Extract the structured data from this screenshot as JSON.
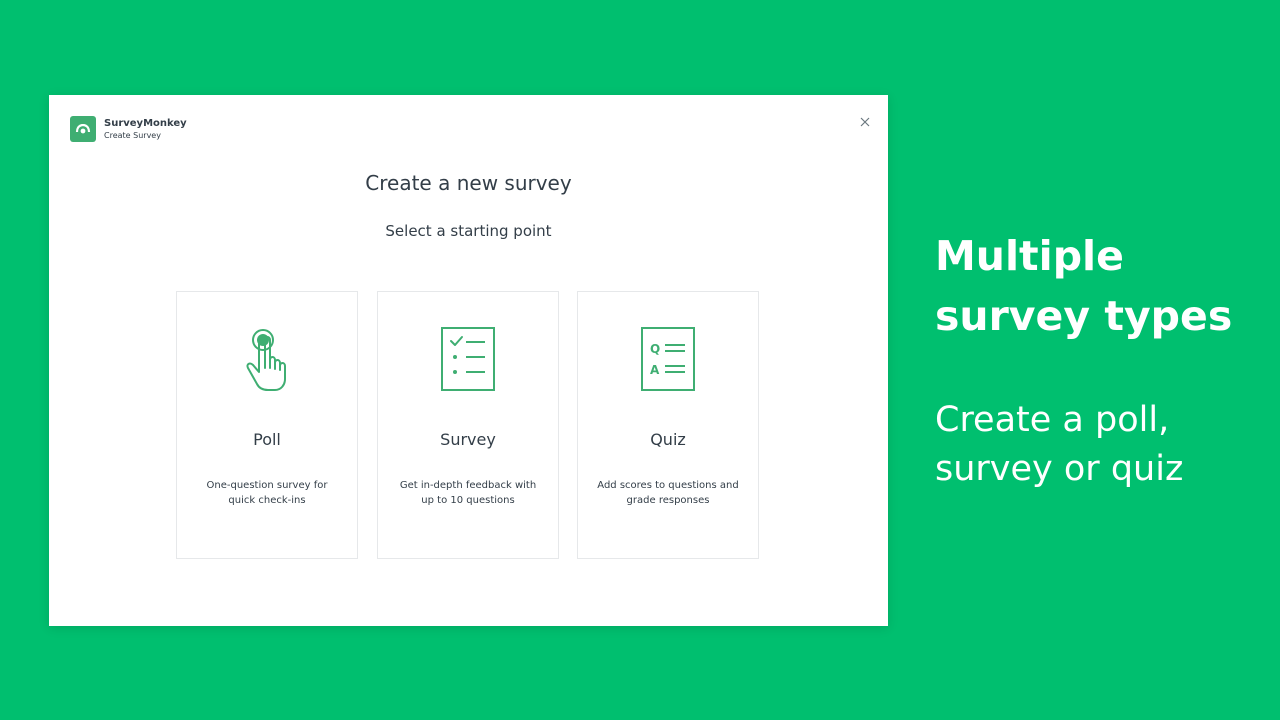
{
  "colors": {
    "background": "#00bf6f",
    "icon_green": "#3fae72",
    "text_dark": "#333e48"
  },
  "dialog": {
    "app_name": "SurveyMonkey",
    "app_subtitle": "Create Survey",
    "close_icon": "close-icon",
    "title": "Create a new survey",
    "subtitle": "Select a starting point",
    "cards": [
      {
        "icon": "tap-hand-icon",
        "title": "Poll",
        "description": "One-question survey for quick check-ins"
      },
      {
        "icon": "checklist-icon",
        "title": "Survey",
        "description": "Get in-depth feedback with up to 10 questions"
      },
      {
        "icon": "question-answer-icon",
        "title": "Quiz",
        "description": "Add scores to questions and grade responses"
      }
    ]
  },
  "promo": {
    "headline": "Multiple survey types",
    "subline": "Create a poll, survey or quiz"
  }
}
